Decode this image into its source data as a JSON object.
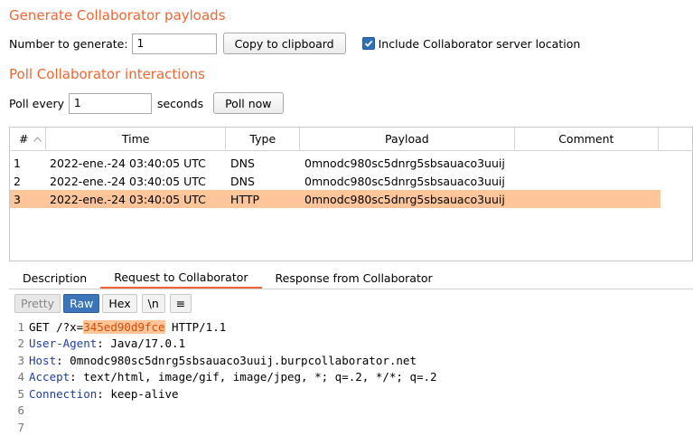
{
  "generate": {
    "title": "Generate Collaborator payloads",
    "number_label": "Number to generate:",
    "number_value": "1",
    "copy_button": "Copy to clipboard",
    "include_label": "Include Collaborator server location"
  },
  "poll": {
    "title": "Poll Collaborator interactions",
    "every_label": "Poll every",
    "every_value": "1",
    "seconds_label": "seconds",
    "poll_now_button": "Poll now"
  },
  "table": {
    "headers": {
      "num": "#",
      "time": "Time",
      "type": "Type",
      "payload": "Payload",
      "comment": "Comment"
    },
    "rows": [
      {
        "num": "1",
        "time": "2022-ene.-24 03:40:05 UTC",
        "type": "DNS",
        "payload": "0mnodc980sc5dnrg5sbsauaco3uuij",
        "comment": ""
      },
      {
        "num": "2",
        "time": "2022-ene.-24 03:40:05 UTC",
        "type": "DNS",
        "payload": "0mnodc980sc5dnrg5sbsauaco3uuij",
        "comment": ""
      },
      {
        "num": "3",
        "time": "2022-ene.-24 03:40:05 UTC",
        "type": "HTTP",
        "payload": "0mnodc980sc5dnrg5sbsauaco3uuij",
        "comment": ""
      }
    ]
  },
  "detail_tabs": [
    "Description",
    "Request to Collaborator",
    "Response from Collaborator"
  ],
  "toolbar": {
    "pretty": "Pretty",
    "raw": "Raw",
    "hex": "Hex",
    "newline": "\\n",
    "menu": "≡"
  },
  "request": {
    "line1": {
      "prefix": "GET /?x=",
      "highlight": "345ed90d9fce",
      "suffix": " HTTP/1.1"
    },
    "headers": [
      {
        "key": "User-Agent",
        "value": " Java/17.0.1"
      },
      {
        "key": "Host",
        "value": " 0mnodc980sc5dnrg5sbsauaco3uuij.burpcollaborator.net"
      },
      {
        "key": "Accept",
        "value": " text/html, image/gif, image/jpeg, *; q=.2, */*; q=.2"
      },
      {
        "key": "Connection",
        "value": " keep-alive"
      }
    ],
    "line_numbers": [
      "1",
      "2",
      "3",
      "4",
      "5",
      "6",
      "7"
    ]
  },
  "colors": {
    "accent": "#ee6633",
    "selection": "#ffc59a",
    "header_key": "#1f3f9a",
    "active_button": "#3b74b9"
  }
}
